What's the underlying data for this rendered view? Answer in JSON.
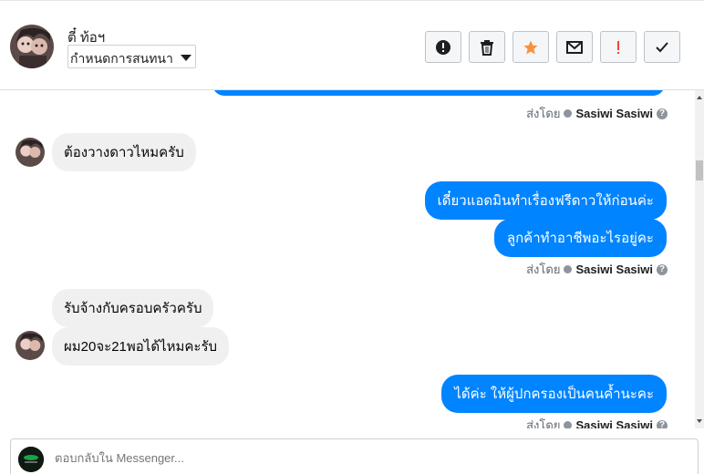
{
  "header": {
    "contact_name": "ตี๋ ท้อฯ",
    "assign_label": "กำหนดการสนทนา"
  },
  "actions": [
    {
      "name": "spam-button",
      "icon": "alert-circle-icon"
    },
    {
      "name": "delete-button",
      "icon": "trash-icon"
    },
    {
      "name": "star-button",
      "icon": "star-icon"
    },
    {
      "name": "mark-unread-button",
      "icon": "envelope-icon"
    },
    {
      "name": "follow-up-button",
      "icon": "exclamation-icon"
    },
    {
      "name": "mark-done-button",
      "icon": "checkmark-icon"
    }
  ],
  "colors": {
    "accent": "#0084ff",
    "star": "#f7923b",
    "alert": "#fa3e3e"
  },
  "messages": {
    "in1": "ต้องวางดาวไหมครับ",
    "out1": "เดี๋ยวแอดมินทำเรื่องฟรีดาวให้ก่อนค่ะ",
    "out2": "ลูกค้าทำอาชีพอะไรอยู่คะ",
    "in2": "รับจ้างกับครอบครัวครับ",
    "in3": "ผม20จะ21พอได้ไหมคะรับ",
    "out3": "ได้ค่ะ ให้ผู้ปกครองเป็นคนค้ำนะคะ"
  },
  "sent_by": {
    "prefix": "ส่งโดย",
    "name": "Sasiwi Sasiwi",
    "help": "?"
  },
  "reply": {
    "placeholder": "ตอบกลับใน Messenger..."
  }
}
